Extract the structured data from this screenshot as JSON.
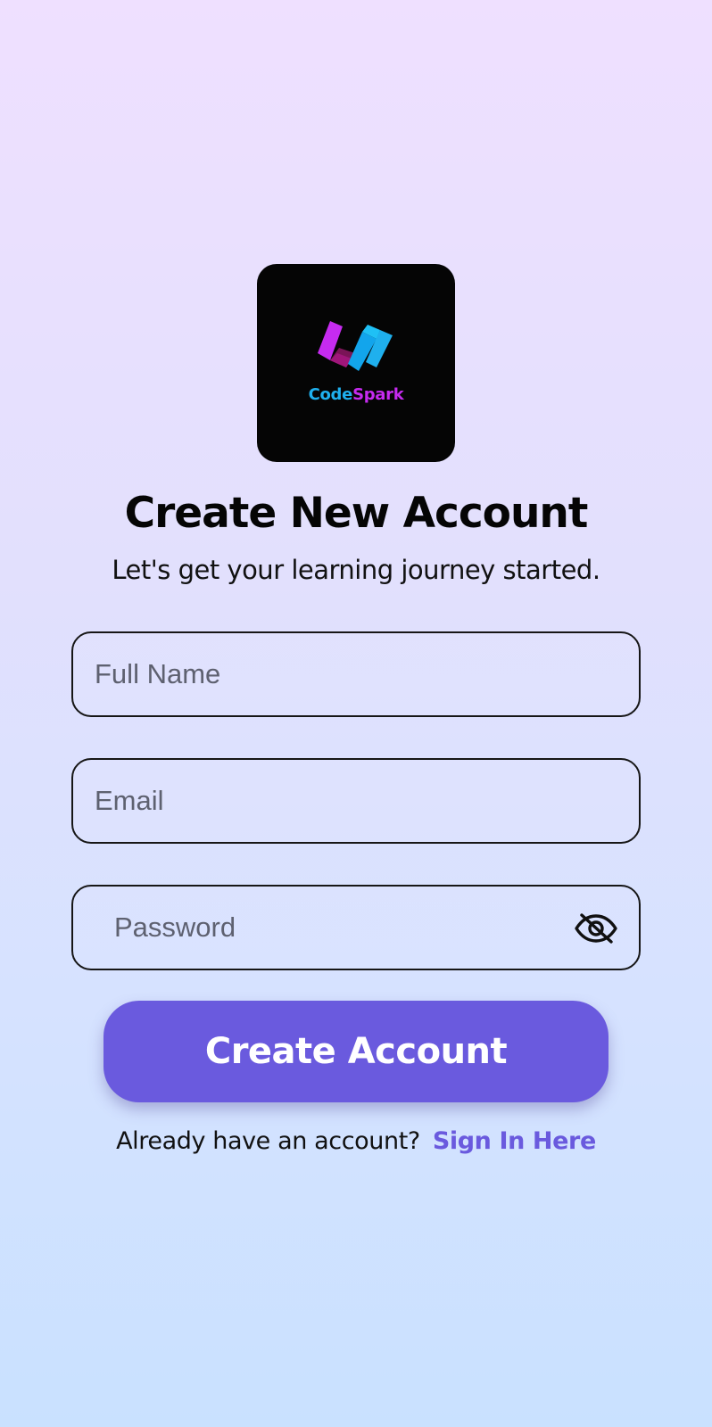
{
  "logo": {
    "icon": "codespark-logo-icon",
    "word_part1": "Code",
    "word_part2": "Spark"
  },
  "header": {
    "title": "Create New Account",
    "subtitle": "Let's get your learning journey started."
  },
  "form": {
    "full_name": {
      "value": "",
      "placeholder": "Full Name"
    },
    "email": {
      "value": "",
      "placeholder": "Email"
    },
    "password": {
      "value": "",
      "placeholder": "Password",
      "visibility_icon": "eye-off-icon"
    }
  },
  "actions": {
    "create_label": "Create Account",
    "signin_prompt": "Already have an account?",
    "signin_link": "Sign In Here"
  },
  "colors": {
    "accent": "#6a5ade",
    "background_top": "#efe0ff",
    "background_bottom": "#c9e1ff",
    "logo_blue": "#1fb0ee",
    "logo_magenta": "#c62bf0"
  }
}
